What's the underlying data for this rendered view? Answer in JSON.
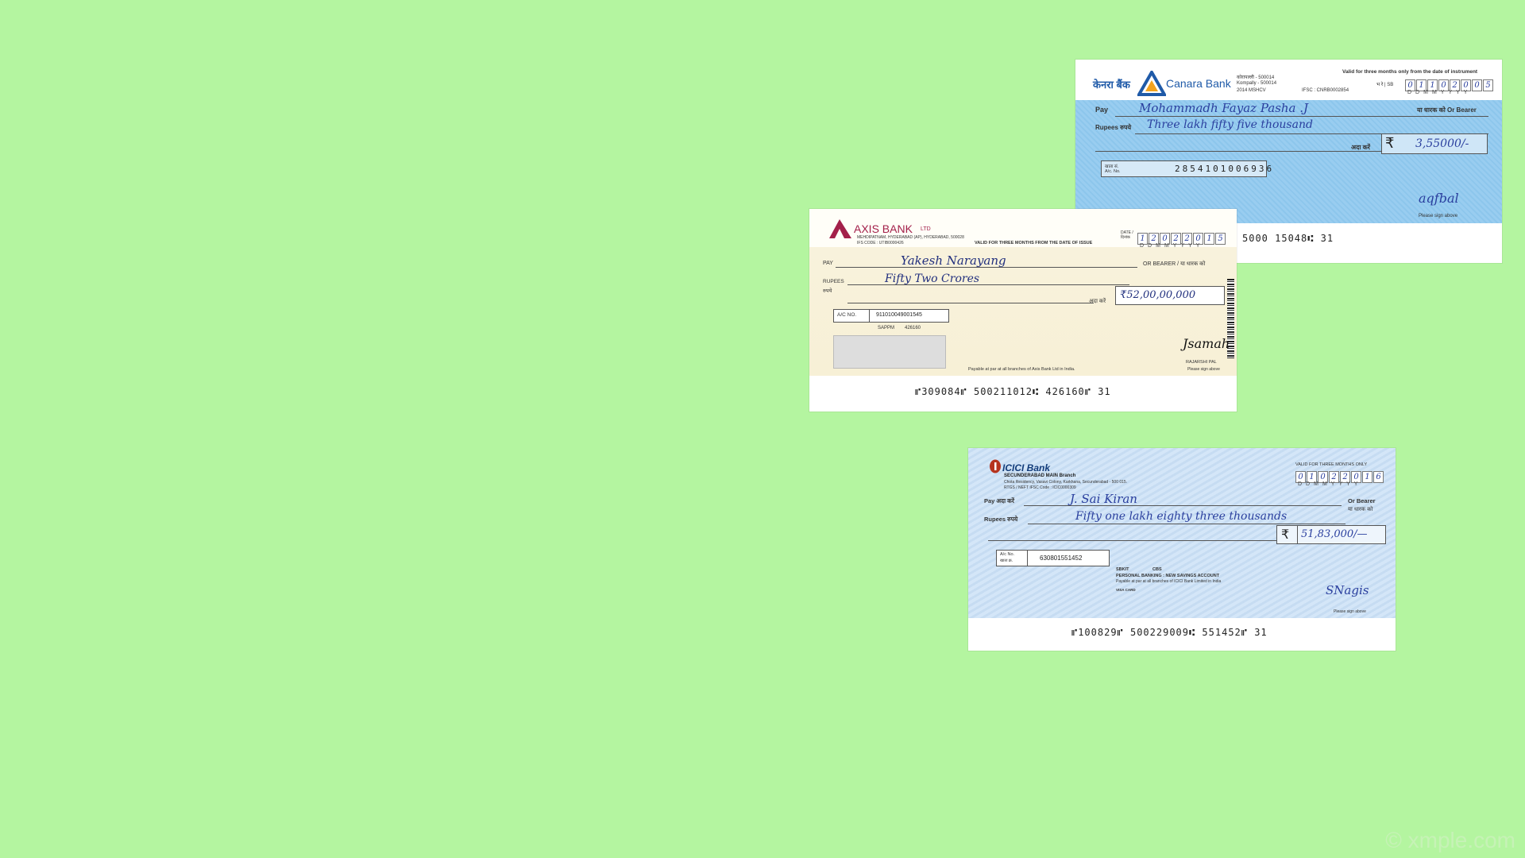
{
  "canara": {
    "bank_name_hindi": "केनरा बैंक",
    "bank_name": "Canara Bank",
    "branch_lines": [
      "कोरापल्ली - 500014",
      "Kompally - 500014",
      "2014 MSHCV"
    ],
    "ifsc": "IFSC : CNRB0002854",
    "validity": "Valid for three months only from the date of instrument",
    "date_label": "भ रे | SB",
    "date_digits": [
      "0",
      "1",
      "1",
      "0",
      "2",
      "0",
      "0",
      "5"
    ],
    "date_format": "DDMMYYYY",
    "pay_label": "Pay",
    "payee": "Mohammadh Fayaz Pasha .J",
    "bearer_label": "या धारक को Or Bearer",
    "rupees_label": "Rupees रुपये",
    "amount_words": "Three lakh fifty five thousand",
    "ada_label": "अदा करें",
    "rupee_symbol": "₹",
    "amount_figures": "3,55000/-",
    "acno_label_hindi": "खाता सं.",
    "acno_label": "A/c. No.",
    "acno": "2854101006936",
    "sign_note": "Please sign above",
    "signature": "aqfbal",
    "micr": "5000 15048⑆    31"
  },
  "axis": {
    "bank_name": "AXIS BANK",
    "bank_suffix": "LTD",
    "address": "MEHDIPATNAM, HYDERABAD (AP), HYDERABAD, 500028",
    "ifs": "IFS CODE : UTIB0000426",
    "validity": "VALID FOR THREE MONTHS FROM THE DATE OF ISSUE",
    "date_label": "DATE / दिनांक",
    "date_digits": [
      "1",
      "2",
      "0",
      "2",
      "2",
      "0",
      "1",
      "5"
    ],
    "date_format": "DDMMYYYY",
    "pay_label": "PAY",
    "payee": "Yakesh Narayang",
    "bearer_label": "OR BEARER / या धारक को",
    "rupees_label": "RUPEES",
    "rupees_label_hindi": "रुपये",
    "amount_words": "Fifty   Two   Crores",
    "ada_label": "अदा करें",
    "amount_figures": "₹52,00,00,000",
    "acno_label": "A/C NO.",
    "acno": "911010049001545",
    "account_type": "SAPPM",
    "account_code": "426160",
    "signatory": "RAJARSHI PAL",
    "sign_note": "Please sign above",
    "signature": "Jsamah",
    "payable": "Payable at par at all branches of Axis Bank Ltd in India.",
    "micr": "⑈309084⑈   500211012⑆  426160⑈  31"
  },
  "icici": {
    "bank_name": "ICICI Bank",
    "branch": "SECUNDERABAD MAIN Branch",
    "address": "Chota Residency, Vasavi Colony, Karkhana, Secunderabad - 500 015.",
    "ifsc": "RTGS / NEFT IFSC Code : ICIC0000309",
    "validity": "VALID FOR THREE MONTHS ONLY",
    "date_digits": [
      "0",
      "1",
      "0",
      "2",
      "2",
      "0",
      "1",
      "6"
    ],
    "date_format": "DDMMYYYY",
    "pay_label": "Pay अदा करें",
    "payee": "J. Sai Kiran",
    "bearer_label": "Or Bearer",
    "bearer_label_hindi": "या धारक को",
    "rupees_label": "Rupees रुपये",
    "amount_words": "Fifty one lakh eighty three thousands",
    "rupee_symbol": "₹",
    "amount_figures": "51,83,000/—",
    "acno_label": "A/c No.",
    "acno_label_hindi": "खाता क्र.",
    "acno": "630801551452",
    "code_left": "SBKIT",
    "code_right": "CBS",
    "account_type": "PERSONAL BANKING : NEW SAVINGS ACCOUNT",
    "payable": "Payable at par at all branches of ICICI Bank Limited in India",
    "card": "VISA CARD",
    "sign_note": "Please sign above",
    "signature": "SNagis",
    "micr": "⑈100829⑈   500229009⑆  551452⑈  31"
  },
  "watermark": "© xmple.com"
}
